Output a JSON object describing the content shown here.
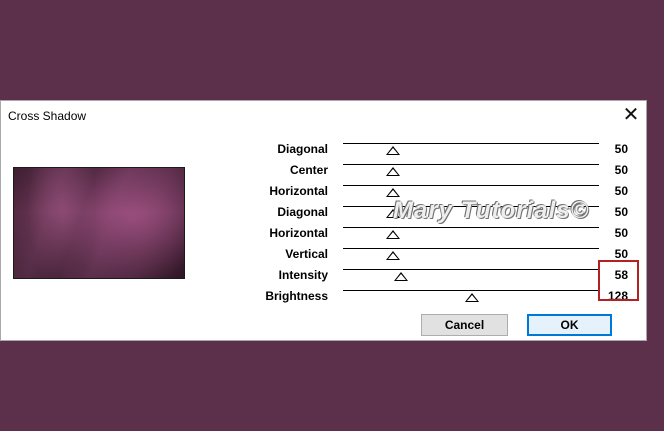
{
  "dialog": {
    "title": "Cross Shadow",
    "close_glyph": "✕"
  },
  "sliders": [
    {
      "label": "Diagonal",
      "value": "50",
      "level": 50
    },
    {
      "label": "Center",
      "value": "50",
      "level": 50
    },
    {
      "label": "Horizontal",
      "value": "50",
      "level": 50
    },
    {
      "label": "Diagonal",
      "value": "50",
      "level": 50
    },
    {
      "label": "Horizontal",
      "value": "50",
      "level": 50
    },
    {
      "label": "Vertical",
      "value": "50",
      "level": 50
    },
    {
      "label": "Intensity",
      "value": "58",
      "level": 58
    },
    {
      "label": "Brightness",
      "value": "128",
      "level": 128
    }
  ],
  "watermark": "Mary Tutorials©",
  "buttons": {
    "cancel_label": "Cancel",
    "ok_label": "OK"
  },
  "colors": {
    "background": "#5c2f4a",
    "highlight_box": "#b22222",
    "ok_border": "#0078d7"
  },
  "icons": {
    "close": "close-icon",
    "thumb": "slider-thumb-icon"
  }
}
